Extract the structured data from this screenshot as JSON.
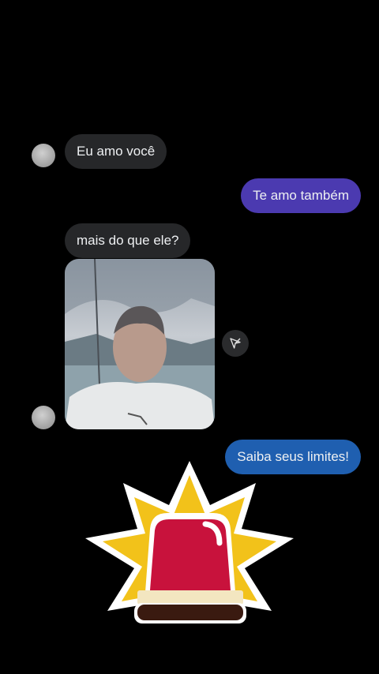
{
  "messages": [
    {
      "side": "incoming",
      "text": "Eu amo você"
    },
    {
      "side": "outgoing",
      "text": "Te amo também",
      "color": "#4b3ab0"
    },
    {
      "side": "incoming",
      "text": "mais do que ele?"
    },
    {
      "side": "incoming",
      "type": "video"
    },
    {
      "side": "outgoing",
      "text": "Saiba seus limites!",
      "color": "#1f5fb0"
    }
  ],
  "icons": {
    "share": "send-arrow-icon",
    "sticker": "siren-alarm-icon"
  },
  "colors": {
    "background": "#000000",
    "incoming_bubble": "#262729",
    "siren_red": "#c8123c",
    "siren_burst": "#f2c21a"
  }
}
